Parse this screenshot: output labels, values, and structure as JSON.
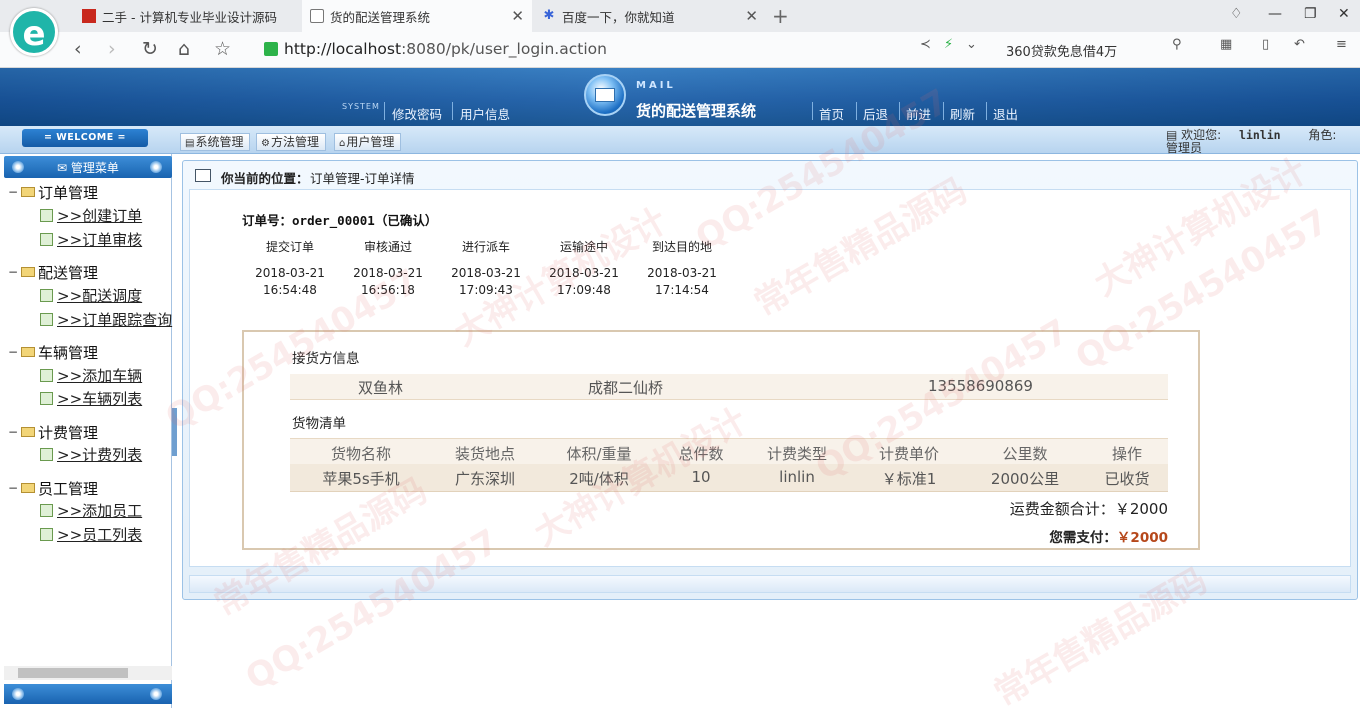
{
  "browser": {
    "tabs": [
      {
        "title": "二手 - 计算机专业毕业设计源码",
        "icon": "red-square-icon",
        "active": false
      },
      {
        "title": "货的配送管理系统",
        "icon": "document-icon",
        "active": true
      },
      {
        "title": "百度一下，你就知道",
        "icon": "baidu-paw-icon",
        "active": false
      }
    ],
    "new_tab": "+",
    "url_host": "http://localhost",
    "url_rest": ":8080/pk/user_login.action",
    "promo_text": "360贷款免息借4万"
  },
  "header": {
    "system_tag": "SYSTEM",
    "left_links": [
      "修改密码",
      "用户信息"
    ],
    "mail_tag": "MAIL",
    "app_title": "货的配送管理系统",
    "right_links": [
      "首页",
      "后退",
      "前进",
      "刷新",
      "退出"
    ]
  },
  "strip": {
    "welcome": "= WELCOME =",
    "tool_buttons": [
      "系统管理",
      "方法管理",
      "用户管理"
    ],
    "welcome_user_label": "欢迎您:",
    "welcome_user_name": "linlin",
    "role_label": "角色:",
    "role_value": "管理员"
  },
  "sidebar": {
    "title": "管理菜单",
    "groups": [
      {
        "label": "订单管理",
        "items": [
          ">>创建订单",
          ">>订单审核"
        ]
      },
      {
        "label": "配送管理",
        "items": [
          ">>配送调度",
          ">>订单跟踪查询"
        ]
      },
      {
        "label": "车辆管理",
        "items": [
          ">>添加车辆",
          ">>车辆列表"
        ]
      },
      {
        "label": "计费管理",
        "items": [
          ">>计费列表"
        ]
      },
      {
        "label": "员工管理",
        "items": [
          ">>添加员工",
          ">>员工列表"
        ]
      }
    ]
  },
  "content": {
    "position_label": "你当前的位置：",
    "position_value": "订单管理-订单详情",
    "order_label": "订单号：",
    "order_no": "order_00001",
    "order_status": "（已确认）",
    "steps": [
      {
        "label": "提交订单",
        "date": "2018-03-21",
        "time": "16:54:48"
      },
      {
        "label": "审核通过",
        "date": "2018-03-21",
        "time": "16:56:18"
      },
      {
        "label": "进行派车",
        "date": "2018-03-21",
        "time": "17:09:43"
      },
      {
        "label": "运输途中",
        "date": "2018-03-21",
        "time": "17:09:48"
      },
      {
        "label": "到达目的地",
        "date": "2018-03-21",
        "time": "17:14:54"
      }
    ],
    "receiver_title": "接货方信息",
    "receiver": {
      "name": "双鱼林",
      "address": "成都二仙桥",
      "phone": "13558690869"
    },
    "goods_title": "货物清单",
    "goods_columns": [
      "货物名称",
      "装货地点",
      "体积/重量",
      "总件数",
      "计费类型",
      "计费单价",
      "公里数",
      "操作"
    ],
    "goods_rows": [
      [
        "苹果5s手机",
        "广东深圳",
        "2吨/体积",
        "10",
        "linlin",
        "￥标准1",
        "2000公里",
        "已收货"
      ]
    ],
    "total_label": "运费金额合计：",
    "total_value": "￥2000",
    "pay_label": "您需支付：",
    "pay_value": "￥2000"
  },
  "colors": {
    "header_blue": "#1c5ea8",
    "sidebar_head": "#1963b0",
    "pay_amount": "#b6481b",
    "detail_border": "#d9c8b0"
  },
  "watermark": {
    "lines": [
      "QQ:254540457",
      "大神计算机设计",
      "常年售精品源码"
    ]
  }
}
